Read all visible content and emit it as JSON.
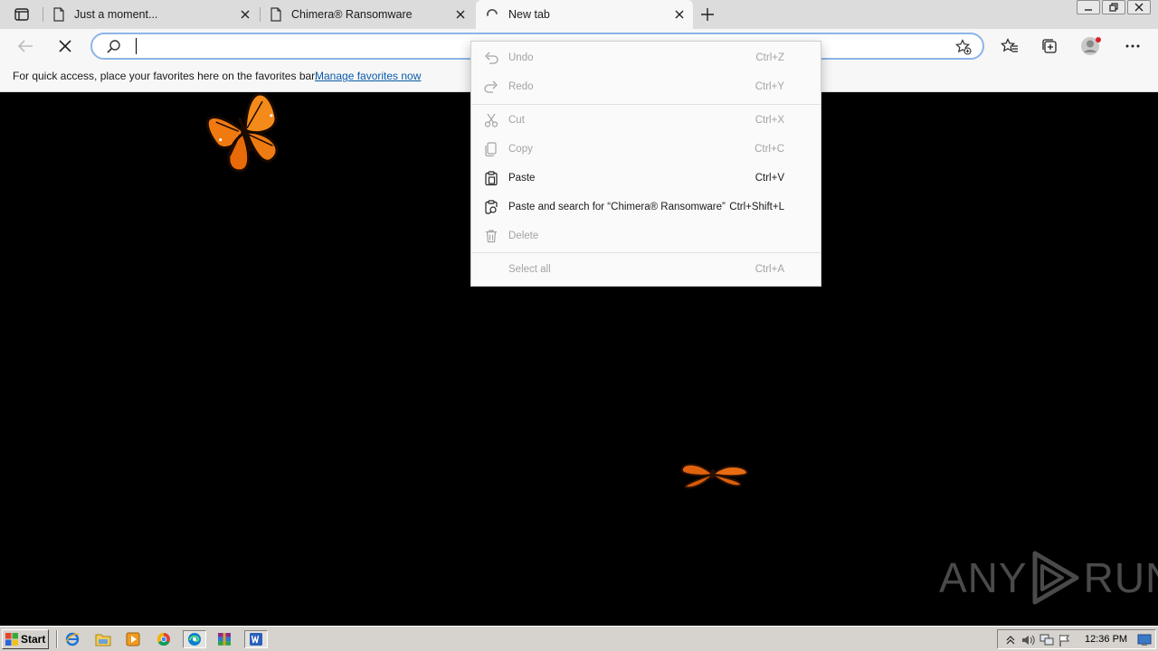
{
  "browser": {
    "tabs": [
      {
        "title": "Just a moment...",
        "icon": "page-icon",
        "state": "inactive"
      },
      {
        "title": "Chimera® Ransomware",
        "icon": "page-icon",
        "state": "inactive"
      },
      {
        "title": "New tab",
        "icon": "loading-spinner-icon",
        "state": "active"
      }
    ],
    "omnibox": {
      "value": "",
      "placeholder": ""
    },
    "favorites_bar": {
      "message": "For quick access, place your favorites here on the favorites bar.",
      "link": "Manage favorites now"
    }
  },
  "context_menu": {
    "items": [
      {
        "label": "Undo",
        "shortcut": "Ctrl+Z",
        "icon": "undo-icon",
        "enabled": false
      },
      {
        "label": "Redo",
        "shortcut": "Ctrl+Y",
        "icon": "redo-icon",
        "enabled": false
      },
      {
        "label": "Cut",
        "shortcut": "Ctrl+X",
        "icon": "scissors-icon",
        "enabled": false
      },
      {
        "label": "Copy",
        "shortcut": "Ctrl+C",
        "icon": "copy-icon",
        "enabled": false
      },
      {
        "label": "Paste",
        "shortcut": "Ctrl+V",
        "icon": "paste-icon",
        "enabled": true
      },
      {
        "label": "Paste and search for “Chimera® Ransomware”",
        "shortcut": "Ctrl+Shift+L",
        "icon": "paste-search-icon",
        "enabled": true
      },
      {
        "label": "Delete",
        "shortcut": "",
        "icon": "trash-icon",
        "enabled": false
      },
      {
        "label": "Select all",
        "shortcut": "Ctrl+A",
        "icon": "",
        "enabled": false
      }
    ]
  },
  "watermark": {
    "left": "ANY",
    "right": "RUN"
  },
  "taskbar": {
    "start_label": "Start",
    "quick_launch": [
      "ie-icon",
      "explorer-icon",
      "media-player-icon",
      "chrome-icon",
      "edge-icon",
      "winrar-icon",
      "word-icon"
    ],
    "clock": "12:36 PM"
  },
  "colors": {
    "accent_border": "#8db5e8",
    "tab_strip": "#dcdcdc",
    "toolbar": "#f7f7f7",
    "link": "#0a5aaa",
    "butterfly": "#f07a10"
  }
}
